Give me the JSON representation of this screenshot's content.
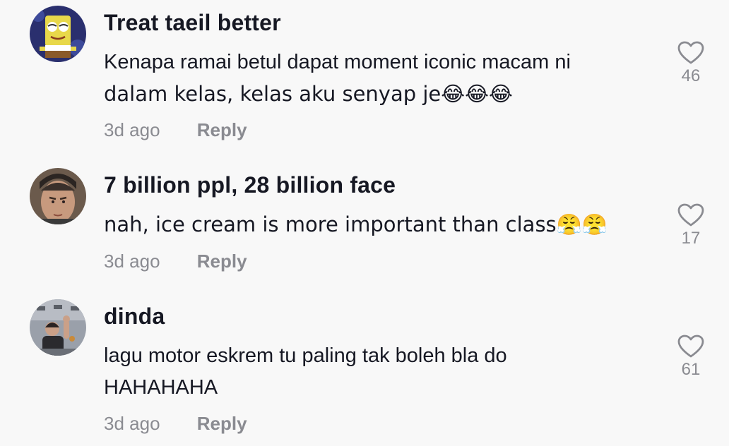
{
  "comments": [
    {
      "username": "Treat taeil better",
      "text_line1": "Kenapa ramai betul dapat moment iconic macam ni",
      "text_line2": "dalam kelas, kelas aku senyap je😂😂😂",
      "time": "3d ago",
      "reply_label": "Reply",
      "like_count": "46",
      "avatar_icon": "spongebob-avatar-icon"
    },
    {
      "username": "7 billion ppl, 28 billion face",
      "text_line1": "nah, ice cream is more important than class😤😤",
      "time": "3d ago",
      "reply_label": "Reply",
      "like_count": "17",
      "avatar_icon": "character-face-avatar-icon"
    },
    {
      "username": "dinda",
      "text_line1": "lagu motor eskrem tu paling tak boleh bla do",
      "text_line2": "HAHAHAHA",
      "time": "3d ago",
      "reply_label": "Reply",
      "like_count": "61",
      "avatar_icon": "person-photo-avatar-icon"
    }
  ],
  "colors": {
    "background": "#f8f8f8",
    "username": "#161823",
    "secondary": "#8a8b91"
  }
}
